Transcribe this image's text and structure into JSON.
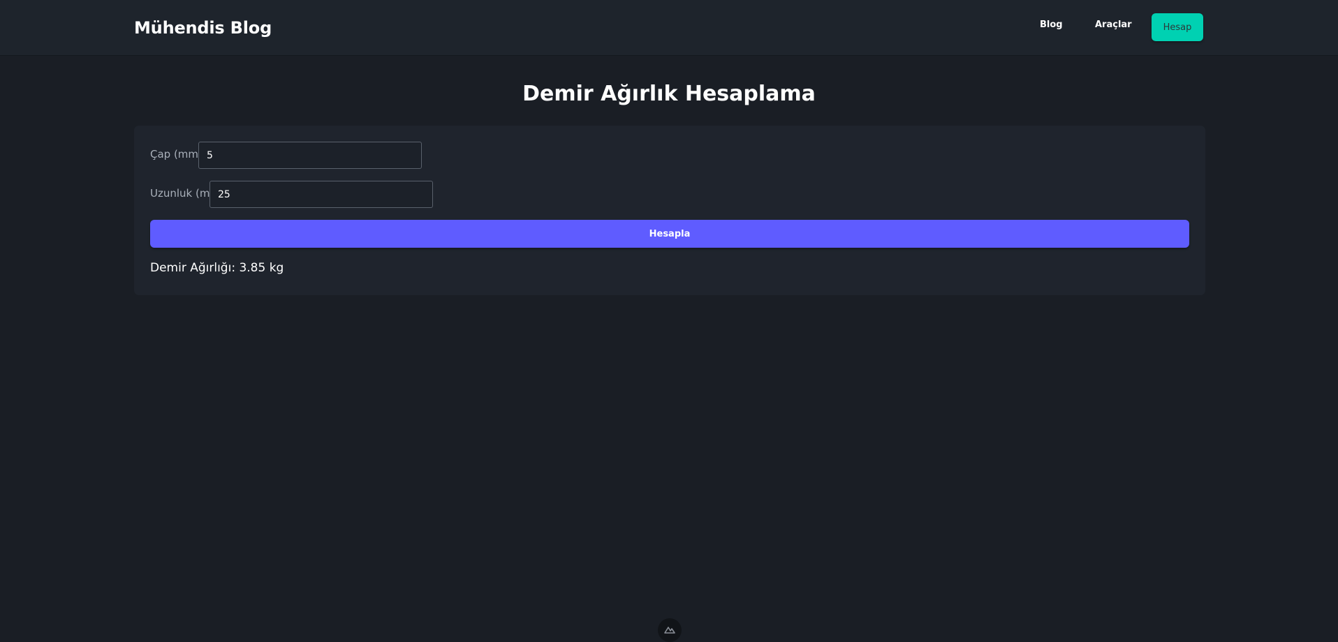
{
  "navbar": {
    "brand": "Mühendis Blog",
    "links": [
      {
        "label": "Blog"
      },
      {
        "label": "Araçlar"
      }
    ],
    "account_button": "Hesap"
  },
  "page": {
    "title": "Demir Ağırlık Hesaplama"
  },
  "form": {
    "diameter_label": "Çap (mm)",
    "diameter_value": "5",
    "length_label": "Uzunluk (m)",
    "length_value": "25",
    "submit_label": "Hesapla"
  },
  "result": {
    "text": "Demir Ağırlığı: 3.85 kg"
  },
  "colors": {
    "background": "#1a1e25",
    "navbar": "#1e242c",
    "card": "#1f242d",
    "accent_teal": "#00d1b2",
    "accent_purple": "#5f5cff"
  },
  "floating_icon": "nuxt-devtools-icon"
}
